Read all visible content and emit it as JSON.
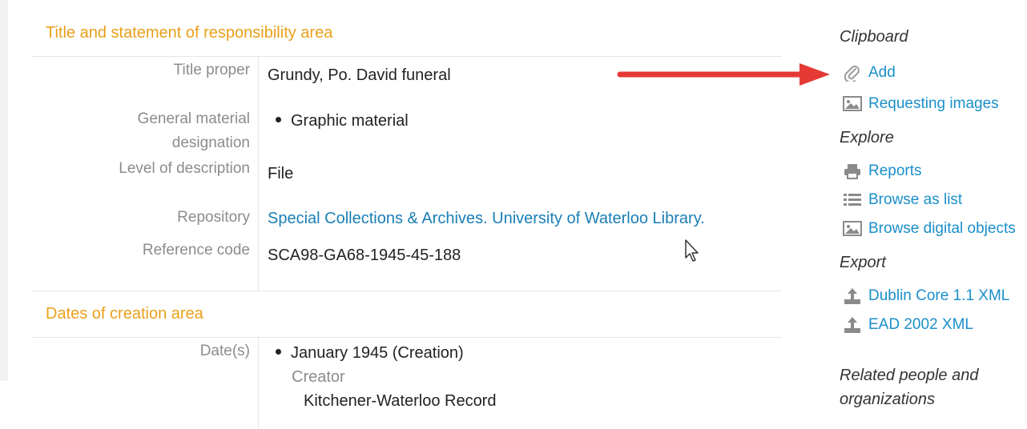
{
  "sections": {
    "title_area": {
      "heading": "Title and statement of responsibility area",
      "fields": {
        "title_proper": {
          "label": "Title proper",
          "value": "Grundy, Po. David funeral"
        },
        "gmd": {
          "label_line1": "General material",
          "label_line2": "designation",
          "value": "Graphic material"
        },
        "level": {
          "label": "Level of description",
          "value": "File"
        },
        "repository": {
          "label": "Repository",
          "value": "Special Collections & Archives. University of Waterloo Library."
        },
        "reference": {
          "label": "Reference code",
          "value": "SCA98-GA68-1945-45-188"
        }
      }
    },
    "dates_area": {
      "heading": "Dates of creation area",
      "fields": {
        "dates": {
          "label": "Date(s)",
          "value": "January 1945 (Creation)",
          "creator_label": "Creator",
          "creator_value": "Kitchener-Waterloo Record"
        }
      }
    }
  },
  "sidebar": {
    "clipboard": {
      "heading": "Clipboard",
      "add": {
        "label": "Add",
        "icon": "paperclip-icon"
      },
      "requesting_images": {
        "label": "Requesting images",
        "icon": "image-icon"
      }
    },
    "explore": {
      "heading": "Explore",
      "reports": {
        "label": "Reports",
        "icon": "printer-icon"
      },
      "browse_list": {
        "label": "Browse as list",
        "icon": "list-icon"
      },
      "browse_digital": {
        "label": "Browse digital objects",
        "icon": "image-icon"
      }
    },
    "export": {
      "heading": "Export",
      "dublin_core": {
        "label": "Dublin Core 1.1 XML",
        "icon": "upload-icon"
      },
      "ead": {
        "label": "EAD 2002 XML",
        "icon": "upload-icon"
      }
    },
    "related": {
      "heading_line1": "Related people and",
      "heading_line2": "organizations"
    }
  },
  "colors": {
    "section_heading": "#e9a01a",
    "link": "#1a8fc9",
    "label": "#8c8c8c",
    "annotation_arrow": "#e53935"
  }
}
